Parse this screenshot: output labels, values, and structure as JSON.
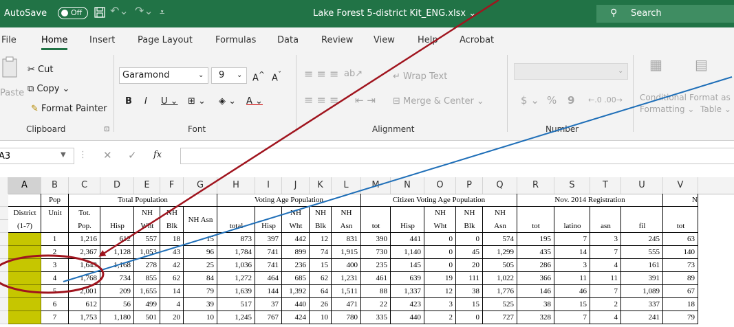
{
  "titlebar": {
    "autosave_label": "AutoSave",
    "autosave_state": "Off",
    "doc_title": "Lake Forest 5-district Kit_ENG.xlsx",
    "search_placeholder": "Search"
  },
  "menu": {
    "tabs": [
      {
        "label": "File"
      },
      {
        "label": "Home",
        "active": true
      },
      {
        "label": "Insert"
      },
      {
        "label": "Page Layout"
      },
      {
        "label": "Formulas"
      },
      {
        "label": "Data"
      },
      {
        "label": "Review"
      },
      {
        "label": "View"
      },
      {
        "label": "Help"
      },
      {
        "label": "Acrobat"
      }
    ]
  },
  "ribbon": {
    "clipboard": {
      "paste": "Paste",
      "cut": "Cut",
      "copy": "Copy",
      "format_painter": "Format Painter",
      "group": "Clipboard"
    },
    "font": {
      "name": "Garamond",
      "size": "9",
      "group": "Font"
    },
    "alignment": {
      "wrap_text": "Wrap Text",
      "merge_center": "Merge & Center",
      "group": "Alignment"
    },
    "number": {
      "currency": "$",
      "percent": "%",
      "comma": "9",
      "group": "Number"
    },
    "styles": {
      "conditional": "Conditional",
      "formatting": "Formatting",
      "format_as": "Format as",
      "table": "Table"
    }
  },
  "formula_bar": {
    "name_box": "A3",
    "fx": "fx",
    "content": ""
  },
  "columns": [
    "A",
    "B",
    "C",
    "D",
    "E",
    "F",
    "G",
    "H",
    "I",
    "J",
    "K",
    "L",
    "M",
    "N",
    "O",
    "P",
    "Q",
    "R",
    "S",
    "T",
    "U",
    "V"
  ],
  "selected_column": "A",
  "sheet": {
    "group_headers": {
      "pop": "Pop",
      "total_population": "Total Population",
      "voting_age": "Voting Age Population",
      "citizen_voting_age": "Citizen Voting Age Population",
      "registration": "Nov. 2014 Registration",
      "next_partial": "N"
    },
    "sub_headers": {
      "district": "District",
      "district_range": "(1-7)",
      "unit": "Unit",
      "tot": "Tot.",
      "pop_dot": "Pop.",
      "hisp": "Hisp",
      "nh": "NH",
      "wht": "Wht",
      "blk": "Blk",
      "nh_asn": "NH Asn",
      "total": "total",
      "asn": "Asn",
      "tot_lower": "tot",
      "latino": "latino",
      "asn_lower": "asn",
      "fil": "fil",
      "tot_v": "tot"
    },
    "rows": [
      [
        "",
        "1",
        "1,216",
        "612",
        "557",
        "18",
        "15",
        "873",
        "397",
        "442",
        "12",
        "831",
        "390",
        "441",
        "0",
        "0",
        "574",
        "195",
        "7",
        "3",
        "245",
        "63"
      ],
      [
        "",
        "2",
        "2,367",
        "1,128",
        "1,053",
        "43",
        "96",
        "1,784",
        "741",
        "899",
        "74",
        "1,915",
        "730",
        "1,140",
        "0",
        "45",
        "1,299",
        "435",
        "14",
        "7",
        "555",
        "140"
      ],
      [
        "",
        "3",
        "1,643",
        "1,168",
        "278",
        "42",
        "25",
        "1,036",
        "741",
        "236",
        "15",
        "400",
        "235",
        "145",
        "0",
        "20",
        "505",
        "286",
        "3",
        "4",
        "161",
        "73"
      ],
      [
        "",
        "4",
        "1,768",
        "734",
        "855",
        "62",
        "84",
        "1,272",
        "464",
        "685",
        "62",
        "1,231",
        "461",
        "639",
        "19",
        "111",
        "1,022",
        "366",
        "11",
        "11",
        "391",
        "89"
      ],
      [
        "",
        "5",
        "2,001",
        "209",
        "1,655",
        "14",
        "79",
        "1,639",
        "144",
        "1,392",
        "64",
        "1,511",
        "88",
        "1,337",
        "12",
        "38",
        "1,776",
        "146",
        "46",
        "7",
        "1,089",
        "67"
      ],
      [
        "",
        "6",
        "612",
        "56",
        "499",
        "4",
        "39",
        "517",
        "37",
        "440",
        "26",
        "471",
        "22",
        "423",
        "3",
        "15",
        "525",
        "38",
        "15",
        "2",
        "337",
        "18"
      ],
      [
        "",
        "7",
        "1,753",
        "1,180",
        "501",
        "20",
        "10",
        "1,245",
        "767",
        "424",
        "10",
        "780",
        "335",
        "440",
        "2",
        "0",
        "727",
        "328",
        "7",
        "4",
        "241",
        "79"
      ]
    ]
  },
  "annotation_colors": {
    "arrow_red": "#a0141e",
    "line_blue": "#1f6fb8",
    "ellipse": "#a0141e",
    "district_fill": "#c6c600"
  }
}
